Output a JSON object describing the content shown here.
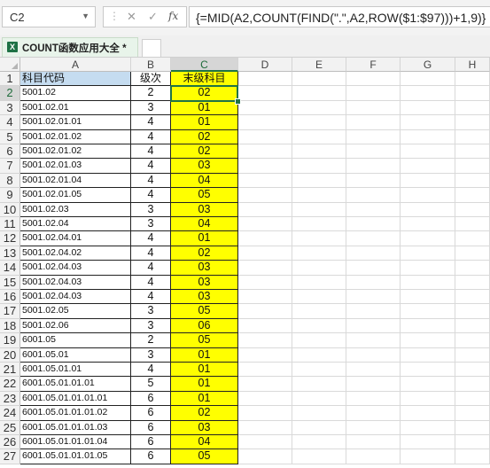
{
  "formula_bar": {
    "name_box": "C2",
    "cancel_glyph": "✕",
    "enter_glyph": "✓",
    "fx_glyph": "fx",
    "formula": "{=MID(A2,COUNT(FIND(\".\",A2,ROW($1:$97)))+1,9)}"
  },
  "tabs": {
    "active_label": "COUNT函数应用大全 *",
    "file_icon": "X"
  },
  "columns": [
    "A",
    "B",
    "C",
    "D",
    "E",
    "F",
    "G",
    "H"
  ],
  "header_row": {
    "a": "科目代码",
    "b": "级次",
    "c": "末级科目"
  },
  "rows": [
    {
      "num": "1"
    },
    {
      "num": "2",
      "a": "5001.02",
      "b": "2",
      "c": "02"
    },
    {
      "num": "3",
      "a": "5001.02.01",
      "b": "3",
      "c": "01"
    },
    {
      "num": "4",
      "a": "5001.02.01.01",
      "b": "4",
      "c": "01"
    },
    {
      "num": "5",
      "a": "5001.02.01.02",
      "b": "4",
      "c": "02"
    },
    {
      "num": "6",
      "a": "5001.02.01.02",
      "b": "4",
      "c": "02"
    },
    {
      "num": "7",
      "a": "5001.02.01.03",
      "b": "4",
      "c": "03"
    },
    {
      "num": "8",
      "a": "5001.02.01.04",
      "b": "4",
      "c": "04"
    },
    {
      "num": "9",
      "a": "5001.02.01.05",
      "b": "4",
      "c": "05"
    },
    {
      "num": "10",
      "a": "5001.02.03",
      "b": "3",
      "c": "03"
    },
    {
      "num": "11",
      "a": "5001.02.04",
      "b": "3",
      "c": "04"
    },
    {
      "num": "12",
      "a": "5001.02.04.01",
      "b": "4",
      "c": "01"
    },
    {
      "num": "13",
      "a": "5001.02.04.02",
      "b": "4",
      "c": "02"
    },
    {
      "num": "14",
      "a": "5001.02.04.03",
      "b": "4",
      "c": "03"
    },
    {
      "num": "15",
      "a": "5001.02.04.03",
      "b": "4",
      "c": "03"
    },
    {
      "num": "16",
      "a": "5001.02.04.03",
      "b": "4",
      "c": "03"
    },
    {
      "num": "17",
      "a": "5001.02.05",
      "b": "3",
      "c": "05"
    },
    {
      "num": "18",
      "a": "5001.02.06",
      "b": "3",
      "c": "06"
    },
    {
      "num": "19",
      "a": "6001.05",
      "b": "2",
      "c": "05"
    },
    {
      "num": "20",
      "a": "6001.05.01",
      "b": "3",
      "c": "01"
    },
    {
      "num": "21",
      "a": "6001.05.01.01",
      "b": "4",
      "c": "01"
    },
    {
      "num": "22",
      "a": "6001.05.01.01.01",
      "b": "5",
      "c": "01"
    },
    {
      "num": "23",
      "a": "6001.05.01.01.01.01",
      "b": "6",
      "c": "01"
    },
    {
      "num": "24",
      "a": "6001.05.01.01.01.02",
      "b": "6",
      "c": "02"
    },
    {
      "num": "25",
      "a": "6001.05.01.01.01.03",
      "b": "6",
      "c": "03"
    },
    {
      "num": "26",
      "a": "6001.05.01.01.01.04",
      "b": "6",
      "c": "04"
    },
    {
      "num": "27",
      "a": "6001.05.01.01.01.05",
      "b": "6",
      "c": "05"
    }
  ],
  "selection": {
    "cell": "C2"
  },
  "colors": {
    "highlight": "#ffff00",
    "header_fill": "#c5dcf0",
    "selection_accent": "#217346"
  }
}
